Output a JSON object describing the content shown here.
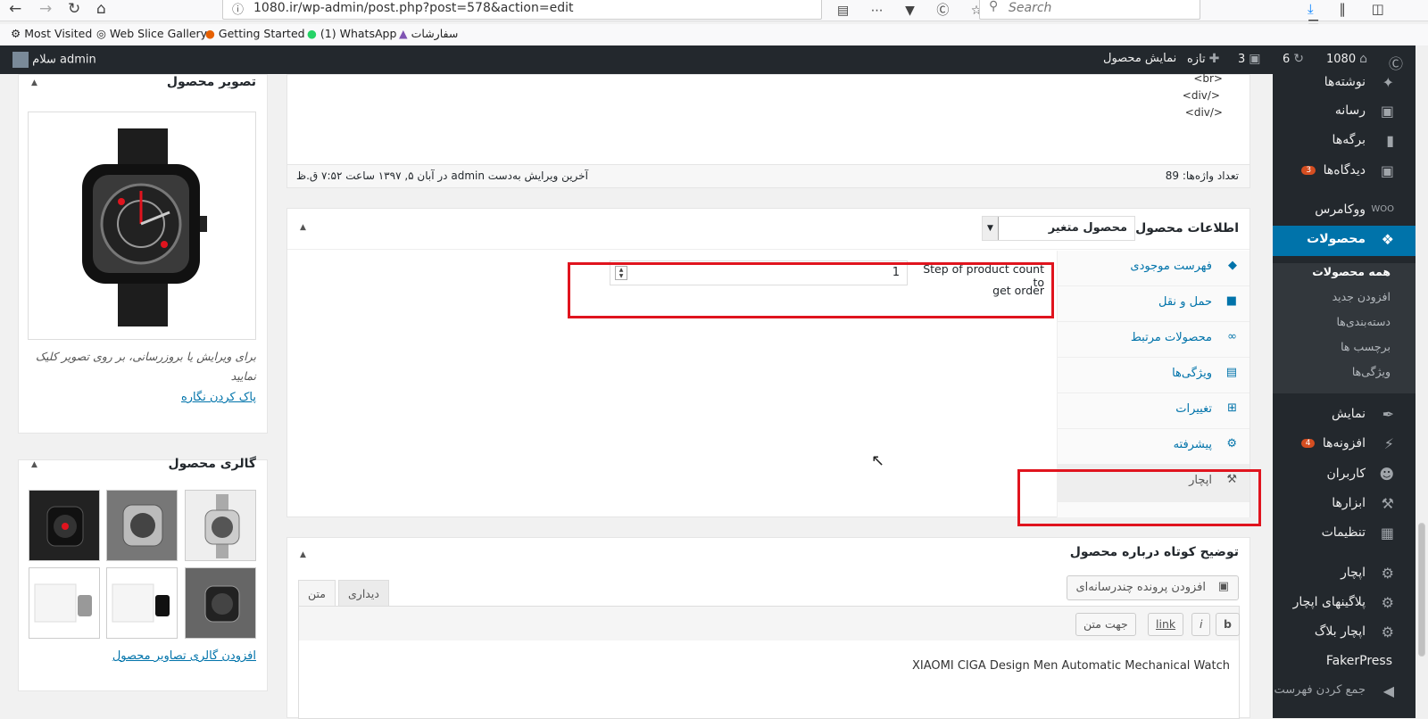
{
  "browser": {
    "url": "1080.ir/wp-admin/post.php?post=578&action=edit",
    "search_placeholder": "Search",
    "bookmarks": [
      "Most Visited",
      "Web Slice Gallery",
      "Getting Started",
      "(1) WhatsApp",
      "سفارشات"
    ]
  },
  "adminbar": {
    "site": "1080",
    "updates": "6",
    "comments": "3",
    "new": "تازه",
    "view_product": "نمایش محصول",
    "greeting": "سلام admin"
  },
  "sidebar": {
    "items": [
      {
        "label": "نوشته‌ها"
      },
      {
        "label": "رسانه"
      },
      {
        "label": "برگه‌ها"
      },
      {
        "label": "دیدگاه‌ها",
        "badge": "3"
      },
      {
        "label": "ووکامرس"
      },
      {
        "label": "محصولات"
      },
      {
        "label": "نمایش"
      },
      {
        "label": "افزونه‌ها",
        "badge": "4"
      },
      {
        "label": "کاربران"
      },
      {
        "label": "ابزارها"
      },
      {
        "label": "تنظیمات"
      },
      {
        "label": "اپچار"
      },
      {
        "label": "پلاگینهای اپچار"
      },
      {
        "label": "اپچار بلاگ"
      },
      {
        "label": "FakerPress"
      },
      {
        "label": "جمع کردن فهرست"
      }
    ],
    "submenu": [
      "همه محصولات",
      "افزودن جدید",
      "دسته‌بندی‌ها",
      "برچسب ها",
      "ویژگی‌ها"
    ]
  },
  "editor": {
    "code_lines": [
      "<br>",
      "<div/>",
      "<div/>"
    ],
    "word_count": "تعداد واژه‌ها: 89",
    "last_edit": "آخرین ویرایش به‌دست admin در آبان ۵, ۱۳۹۷ ساعت ۷:۵۲ ق.ظ"
  },
  "product_data": {
    "title": "اطلاعات محصول —",
    "type_value": "محصول متغیر",
    "tabs": [
      "فهرست موجودی",
      "حمل و نقل",
      "محصولات مرتبط",
      "ویژگی‌ها",
      "تغییرات",
      "پیشرفته",
      "اپچار"
    ],
    "field_label_line1": "Step of product count to",
    "field_label_line2": "get order",
    "field_value": "1"
  },
  "short_desc": {
    "title": "توضیح کوتاه درباره محصول",
    "add_media": "افزودن پرونده چندرسانه‌ای",
    "tab_visual": "دیداری",
    "tab_text": "متن",
    "qt_buttons": [
      "b",
      "i",
      "link",
      "جهت متن"
    ],
    "content": "XIAOMI CIGA Design Men Automatic Mechanical Watch"
  },
  "product_image": {
    "title": "تصویر محصول",
    "hint": "برای ویرایش یا بروزرسانی، بر روی تصویر کلیک نمایید",
    "remove_link": "پاک کردن نگاره"
  },
  "gallery": {
    "title": "گالری محصول",
    "add_link": "افزودن گالری تصاویر محصول"
  }
}
